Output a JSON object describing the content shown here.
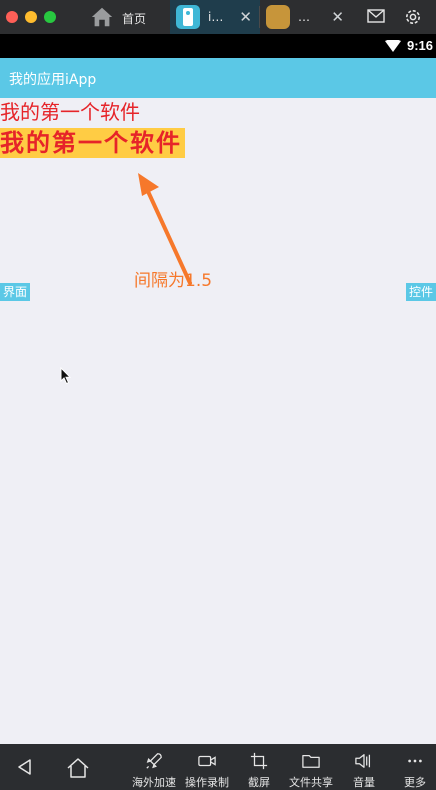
{
  "window": {
    "tabs": [
      {
        "label": "首页",
        "icon": "home-icon"
      },
      {
        "label": "i…",
        "icon": "iapp-icon"
      },
      {
        "label": "…",
        "icon": "app-icon"
      }
    ],
    "close_glyph": "✕"
  },
  "status_bar": {
    "time": "9:16"
  },
  "action_bar": {
    "title": "我的应用iApp"
  },
  "content": {
    "text_plain": "我的第一个软件",
    "text_highlight": "我的第一个软件",
    "annotation": "间隔为1.5",
    "button_left": "界面",
    "button_right": "控件"
  },
  "toolbar": {
    "items": [
      {
        "label": "海外加速",
        "icon": "rocket-icon"
      },
      {
        "label": "操作录制",
        "icon": "video-icon"
      },
      {
        "label": "截屏",
        "icon": "crop-icon"
      },
      {
        "label": "文件共享",
        "icon": "folder-icon"
      },
      {
        "label": "音量",
        "icon": "volume-icon"
      },
      {
        "label": "更多",
        "icon": "more-icon"
      }
    ]
  },
  "colors": {
    "accent": "#5bc8e6",
    "text_red": "#e62429",
    "highlight": "#ffcc44",
    "annotation": "#f6782b"
  }
}
